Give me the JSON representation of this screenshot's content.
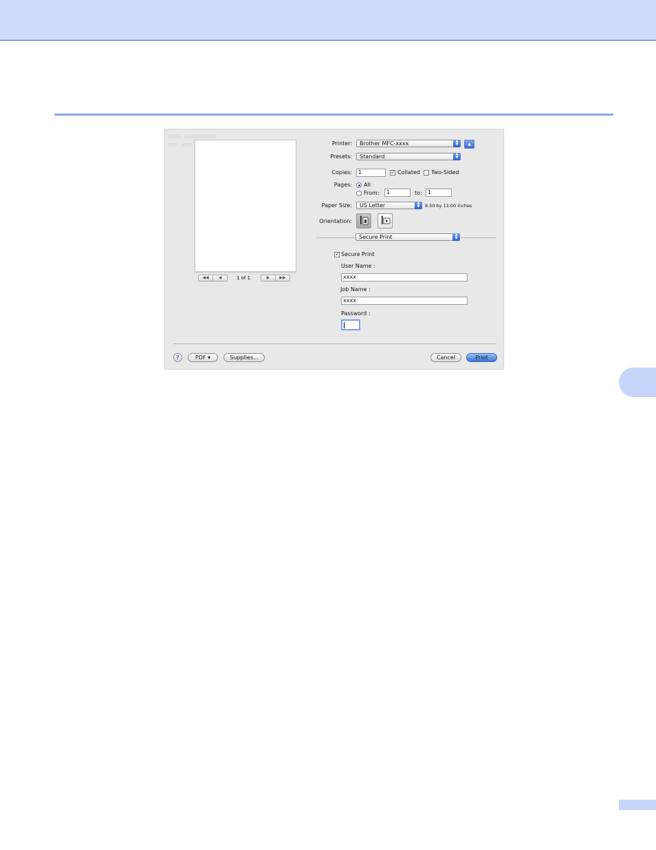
{
  "dialog": {
    "preview": {
      "page_counter": "1 of 1",
      "nav_prev": [
        "◀◀",
        "◀"
      ],
      "nav_next": [
        "▶",
        "▶▶"
      ]
    },
    "printer": {
      "label": "Printer:",
      "value": "Brother MFC-xxxx"
    },
    "presets": {
      "label": "Presets:",
      "value": "Standard"
    },
    "copies": {
      "label": "Copies:",
      "value": "1",
      "collated_label": "Collated",
      "collated": true,
      "two_sided_label": "Two-Sided",
      "two_sided": false
    },
    "pages": {
      "label": "Pages:",
      "all_label": "All",
      "from_label": "From:",
      "from_value": "1",
      "to_label": "to:",
      "to_value": "1",
      "selected": "All"
    },
    "paper_size": {
      "label": "Paper Size:",
      "value": "US Letter",
      "dimensions": "8.50 by 11.00 inches"
    },
    "orientation": {
      "label": "Orientation:",
      "selected": "portrait"
    },
    "panel_menu": {
      "value": "Secure Print"
    },
    "secure_print": {
      "checkbox_label": "Secure Print",
      "checked": true,
      "user_name_label": "User Name :",
      "user_name_value": "xxxx",
      "job_name_label": "Job Name :",
      "job_name_value": "xxxx",
      "password_label": "Password :",
      "password_value": ""
    },
    "footer": {
      "help_symbol": "?",
      "pdf_label": "PDF ▾",
      "supplies_label": "Supplies...",
      "cancel_label": "Cancel",
      "print_label": "Print"
    }
  },
  "colors": {
    "header_band": "#cddcfb",
    "accent_rule": "#8ea6ec",
    "primary_button": "#3b74d8"
  }
}
